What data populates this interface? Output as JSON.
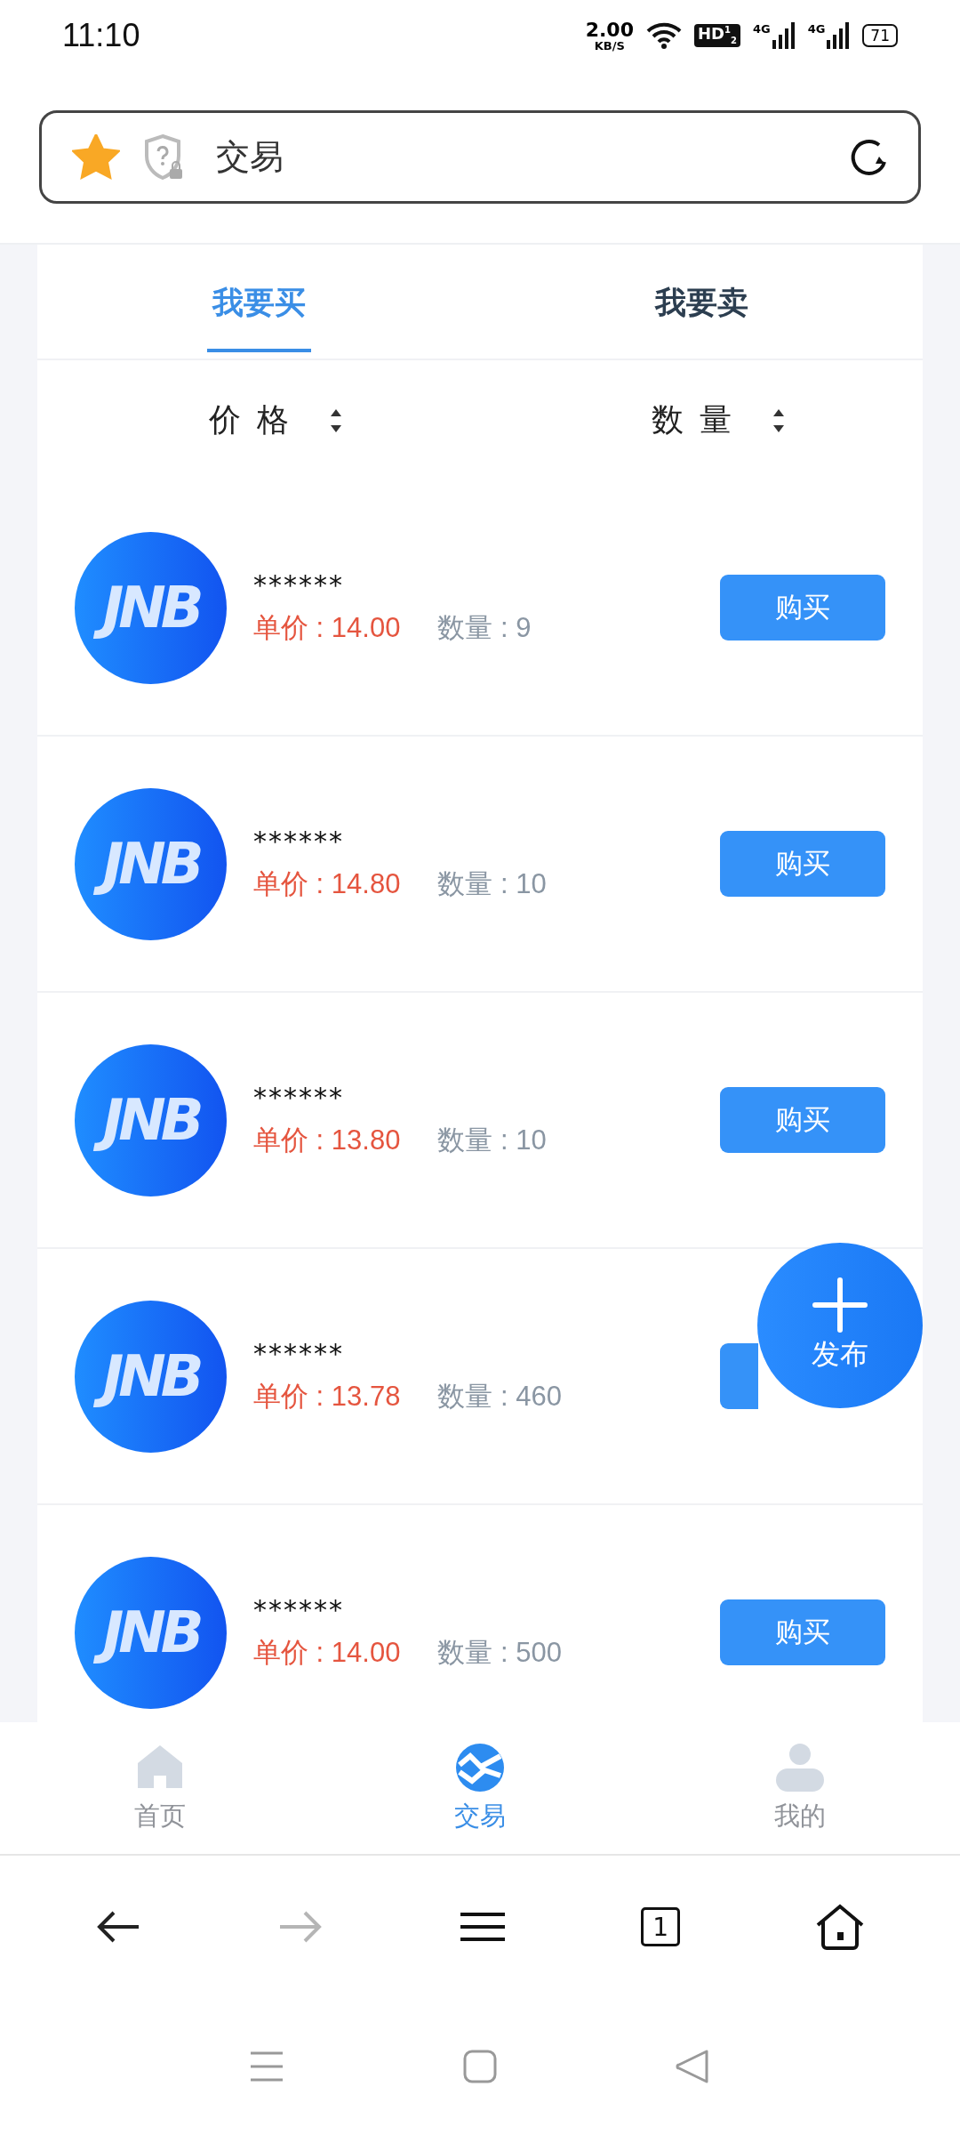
{
  "status_bar": {
    "time": "11:10",
    "net_speed": "2.00",
    "net_unit": "KB/S",
    "hd_badge": "HD$^{1}$$_{2}$",
    "signals": [
      "4G",
      "4G"
    ],
    "battery": "71"
  },
  "address_bar": {
    "title": "交易",
    "bookmarked": true
  },
  "tabs": [
    {
      "label": "我要买",
      "selected": true
    },
    {
      "label": "我要卖",
      "selected": false
    }
  ],
  "sort_options": [
    {
      "label": "价格"
    },
    {
      "label": "数量"
    }
  ],
  "listings": [
    {
      "logo": "JNB",
      "name": "******",
      "price": "单价 : 14.00",
      "quantity": "数量 : 9",
      "action": "购买"
    },
    {
      "logo": "JNB",
      "name": "******",
      "price": "单价 : 14.80",
      "quantity": "数量 : 10",
      "action": "购买"
    },
    {
      "logo": "JNB",
      "name": "******",
      "price": "单价 : 13.80",
      "quantity": "数量 : 10",
      "action": "购买"
    },
    {
      "logo": "JNB",
      "name": "******",
      "price": "单价 : 13.78",
      "quantity": "数量 : 460"
    },
    {
      "logo": "JNB",
      "name": "******",
      "price": "单价 : 14.00",
      "quantity": "数量 : 500",
      "action": "购买"
    }
  ],
  "fab": {
    "label": "发布"
  },
  "bottom_nav": [
    {
      "label": "首页",
      "kind": "home",
      "selected": false
    },
    {
      "label": "交易",
      "kind": "trade",
      "selected": true
    },
    {
      "label": "我的",
      "kind": "profile",
      "selected": false
    }
  ],
  "browser_toolbar": {
    "tab_count": "1",
    "forward_disabled": true
  }
}
